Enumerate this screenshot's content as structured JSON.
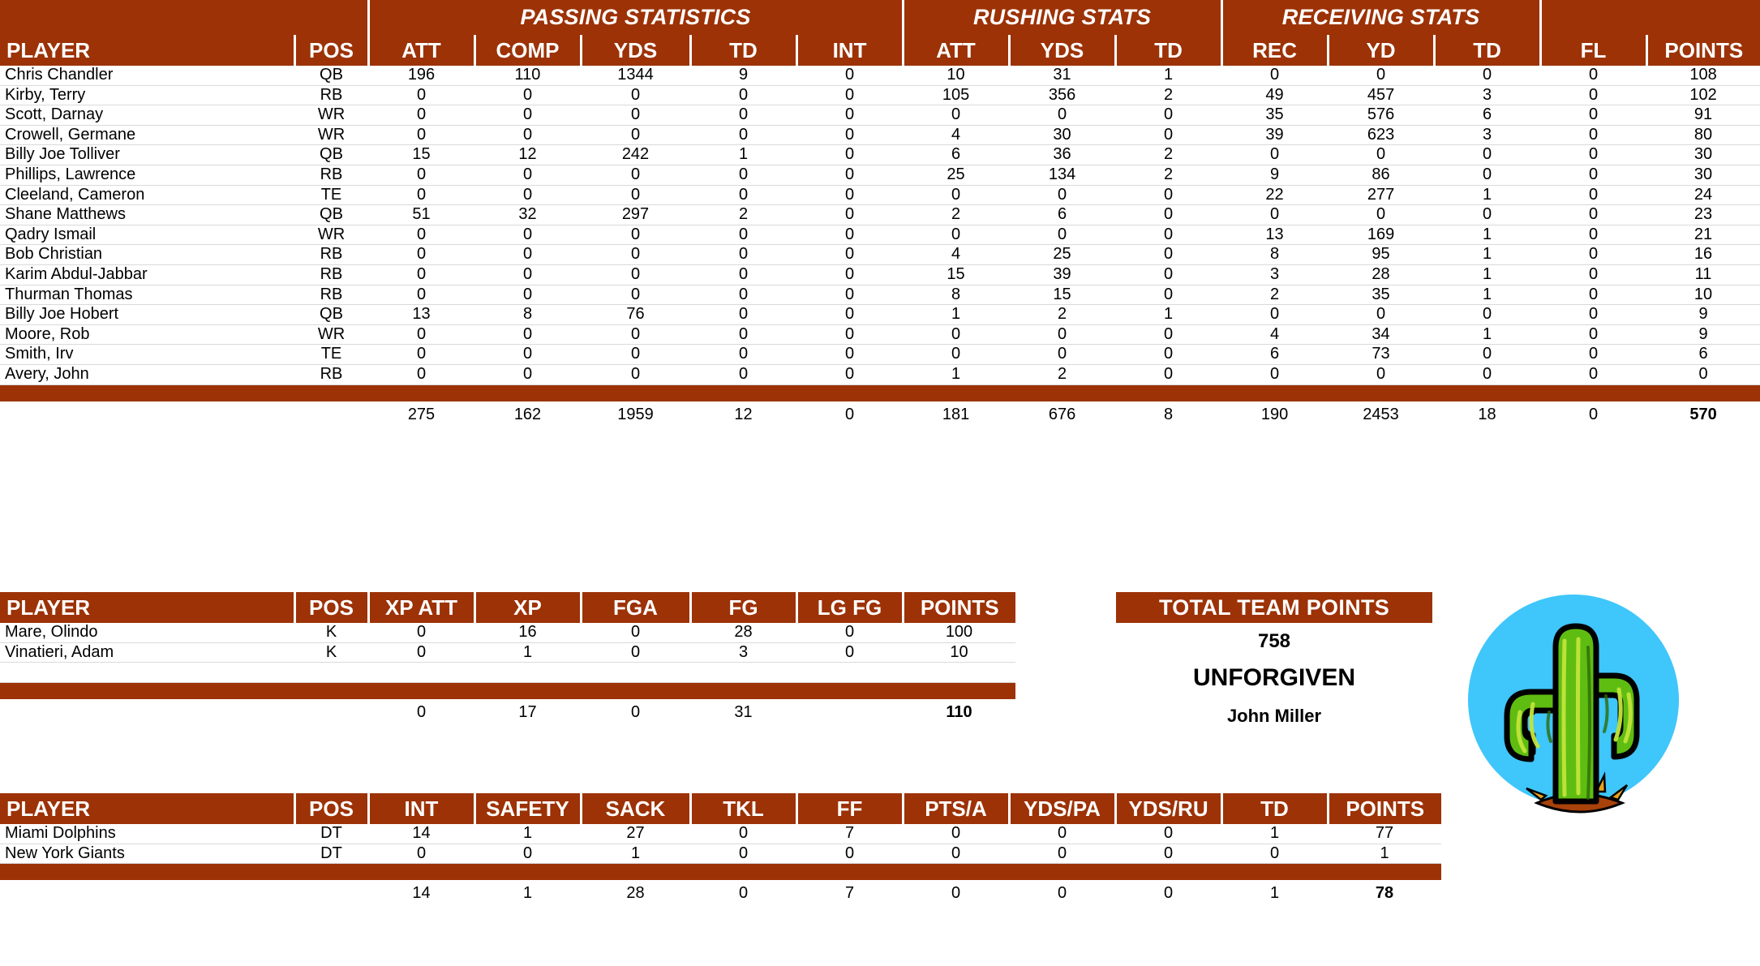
{
  "colors": {
    "header_bg": "#9c3206",
    "header_text": "#ffffff",
    "grid_line": "#dadada",
    "logo_circle": "#3fc6fb",
    "logo_cactus": "#6fbf12",
    "logo_dirt": "#a8420a"
  },
  "offense": {
    "group_headers": [
      {
        "label": "",
        "span": 2
      },
      {
        "label": "PASSING STATISTICS",
        "span": 5
      },
      {
        "label": "RUSHING STATS",
        "span": 3
      },
      {
        "label": "RECEIVING STATS",
        "span": 3
      },
      {
        "label": "",
        "span": 2
      }
    ],
    "columns": [
      "PLAYER",
      "POS",
      "ATT",
      "COMP",
      "YDS",
      "TD",
      "INT",
      "ATT",
      "YDS",
      "TD",
      "REC",
      "YD",
      "TD",
      "FL",
      "POINTS"
    ],
    "rows": [
      {
        "player": "Chris Chandler",
        "pos": "QB",
        "pass_att": "196",
        "pass_comp": "110",
        "pass_yds": "1344",
        "pass_td": "9",
        "pass_int": "0",
        "rush_att": "10",
        "rush_yds": "31",
        "rush_td": "1",
        "rec": "0",
        "rec_yd": "0",
        "rec_td": "0",
        "fl": "0",
        "points": "108"
      },
      {
        "player": "Kirby, Terry",
        "pos": "RB",
        "pass_att": "0",
        "pass_comp": "0",
        "pass_yds": "0",
        "pass_td": "0",
        "pass_int": "0",
        "rush_att": "105",
        "rush_yds": "356",
        "rush_td": "2",
        "rec": "49",
        "rec_yd": "457",
        "rec_td": "3",
        "fl": "0",
        "points": "102"
      },
      {
        "player": "Scott, Darnay",
        "pos": "WR",
        "pass_att": "0",
        "pass_comp": "0",
        "pass_yds": "0",
        "pass_td": "0",
        "pass_int": "0",
        "rush_att": "0",
        "rush_yds": "0",
        "rush_td": "0",
        "rec": "35",
        "rec_yd": "576",
        "rec_td": "6",
        "fl": "0",
        "points": "91"
      },
      {
        "player": "Crowell, Germane",
        "pos": "WR",
        "pass_att": "0",
        "pass_comp": "0",
        "pass_yds": "0",
        "pass_td": "0",
        "pass_int": "0",
        "rush_att": "4",
        "rush_yds": "30",
        "rush_td": "0",
        "rec": "39",
        "rec_yd": "623",
        "rec_td": "3",
        "fl": "0",
        "points": "80"
      },
      {
        "player": "Billy Joe Tolliver",
        "pos": "QB",
        "pass_att": "15",
        "pass_comp": "12",
        "pass_yds": "242",
        "pass_td": "1",
        "pass_int": "0",
        "rush_att": "6",
        "rush_yds": "36",
        "rush_td": "2",
        "rec": "0",
        "rec_yd": "0",
        "rec_td": "0",
        "fl": "0",
        "points": "30"
      },
      {
        "player": "Phillips, Lawrence",
        "pos": "RB",
        "pass_att": "0",
        "pass_comp": "0",
        "pass_yds": "0",
        "pass_td": "0",
        "pass_int": "0",
        "rush_att": "25",
        "rush_yds": "134",
        "rush_td": "2",
        "rec": "9",
        "rec_yd": "86",
        "rec_td": "0",
        "fl": "0",
        "points": "30"
      },
      {
        "player": "Cleeland, Cameron",
        "pos": "TE",
        "pass_att": "0",
        "pass_comp": "0",
        "pass_yds": "0",
        "pass_td": "0",
        "pass_int": "0",
        "rush_att": "0",
        "rush_yds": "0",
        "rush_td": "0",
        "rec": "22",
        "rec_yd": "277",
        "rec_td": "1",
        "fl": "0",
        "points": "24"
      },
      {
        "player": "Shane Matthews",
        "pos": "QB",
        "pass_att": "51",
        "pass_comp": "32",
        "pass_yds": "297",
        "pass_td": "2",
        "pass_int": "0",
        "rush_att": "2",
        "rush_yds": "6",
        "rush_td": "0",
        "rec": "0",
        "rec_yd": "0",
        "rec_td": "0",
        "fl": "0",
        "points": "23"
      },
      {
        "player": "Qadry Ismail",
        "pos": "WR",
        "pass_att": "0",
        "pass_comp": "0",
        "pass_yds": "0",
        "pass_td": "0",
        "pass_int": "0",
        "rush_att": "0",
        "rush_yds": "0",
        "rush_td": "0",
        "rec": "13",
        "rec_yd": "169",
        "rec_td": "1",
        "fl": "0",
        "points": "21"
      },
      {
        "player": "Bob Christian",
        "pos": "RB",
        "pass_att": "0",
        "pass_comp": "0",
        "pass_yds": "0",
        "pass_td": "0",
        "pass_int": "0",
        "rush_att": "4",
        "rush_yds": "25",
        "rush_td": "0",
        "rec": "8",
        "rec_yd": "95",
        "rec_td": "1",
        "fl": "0",
        "points": "16"
      },
      {
        "player": "Karim Abdul-Jabbar",
        "pos": "RB",
        "pass_att": "0",
        "pass_comp": "0",
        "pass_yds": "0",
        "pass_td": "0",
        "pass_int": "0",
        "rush_att": "15",
        "rush_yds": "39",
        "rush_td": "0",
        "rec": "3",
        "rec_yd": "28",
        "rec_td": "1",
        "fl": "0",
        "points": "11"
      },
      {
        "player": "Thurman Thomas",
        "pos": "RB",
        "pass_att": "0",
        "pass_comp": "0",
        "pass_yds": "0",
        "pass_td": "0",
        "pass_int": "0",
        "rush_att": "8",
        "rush_yds": "15",
        "rush_td": "0",
        "rec": "2",
        "rec_yd": "35",
        "rec_td": "1",
        "fl": "0",
        "points": "10"
      },
      {
        "player": "Billy Joe Hobert",
        "pos": "QB",
        "pass_att": "13",
        "pass_comp": "8",
        "pass_yds": "76",
        "pass_td": "0",
        "pass_int": "0",
        "rush_att": "1",
        "rush_yds": "2",
        "rush_td": "1",
        "rec": "0",
        "rec_yd": "0",
        "rec_td": "0",
        "fl": "0",
        "points": "9"
      },
      {
        "player": "Moore, Rob",
        "pos": "WR",
        "pass_att": "0",
        "pass_comp": "0",
        "pass_yds": "0",
        "pass_td": "0",
        "pass_int": "0",
        "rush_att": "0",
        "rush_yds": "0",
        "rush_td": "0",
        "rec": "4",
        "rec_yd": "34",
        "rec_td": "1",
        "fl": "0",
        "points": "9"
      },
      {
        "player": "Smith, Irv",
        "pos": "TE",
        "pass_att": "0",
        "pass_comp": "0",
        "pass_yds": "0",
        "pass_td": "0",
        "pass_int": "0",
        "rush_att": "0",
        "rush_yds": "0",
        "rush_td": "0",
        "rec": "6",
        "rec_yd": "73",
        "rec_td": "0",
        "fl": "0",
        "points": "6"
      },
      {
        "player": "Avery, John",
        "pos": "RB",
        "pass_att": "0",
        "pass_comp": "0",
        "pass_yds": "0",
        "pass_td": "0",
        "pass_int": "0",
        "rush_att": "1",
        "rush_yds": "2",
        "rush_td": "0",
        "rec": "0",
        "rec_yd": "0",
        "rec_td": "0",
        "fl": "0",
        "points": "0"
      }
    ],
    "totals": {
      "player": "",
      "pos": "",
      "pass_att": "275",
      "pass_comp": "162",
      "pass_yds": "1959",
      "pass_td": "12",
      "pass_int": "0",
      "rush_att": "181",
      "rush_yds": "676",
      "rush_td": "8",
      "rec": "190",
      "rec_yd": "2453",
      "rec_td": "18",
      "fl": "0",
      "points": "570"
    }
  },
  "kicking": {
    "columns": [
      "PLAYER",
      "POS",
      "XP ATT",
      "XP",
      "FGA",
      "FG",
      "LG FG",
      "POINTS"
    ],
    "rows": [
      {
        "player": "Mare, Olindo",
        "pos": "K",
        "xp_att": "0",
        "xp": "16",
        "fga": "0",
        "fg": "28",
        "lg_fg": "0",
        "points": "100"
      },
      {
        "player": "Vinatieri, Adam",
        "pos": "K",
        "xp_att": "0",
        "xp": "1",
        "fga": "0",
        "fg": "3",
        "lg_fg": "0",
        "points": "10"
      }
    ],
    "totals": {
      "player": "",
      "pos": "",
      "xp_att": "0",
      "xp": "17",
      "fga": "0",
      "fg": "31",
      "lg_fg": "",
      "points": "110"
    }
  },
  "defense": {
    "columns": [
      "PLAYER",
      "POS",
      "INT",
      "SAFETY",
      "SACK",
      "TKL",
      "FF",
      "PTS/A",
      "YDS/PA",
      "YDS/RU",
      "TD",
      "POINTS"
    ],
    "rows": [
      {
        "player": "Miami Dolphins",
        "pos": "DT",
        "int": "14",
        "safety": "1",
        "sack": "27",
        "tkl": "0",
        "ff": "7",
        "pts_a": "0",
        "yds_pa": "0",
        "yds_ru": "0",
        "td": "1",
        "points": "77"
      },
      {
        "player": "New York Giants",
        "pos": "DT",
        "int": "0",
        "safety": "0",
        "sack": "1",
        "tkl": "0",
        "ff": "0",
        "pts_a": "0",
        "yds_pa": "0",
        "yds_ru": "0",
        "td": "0",
        "points": "1"
      }
    ],
    "totals": {
      "player": "",
      "pos": "",
      "int": "14",
      "safety": "1",
      "sack": "28",
      "tkl": "0",
      "ff": "7",
      "pts_a": "0",
      "yds_pa": "0",
      "yds_ru": "0",
      "td": "1",
      "points": "78"
    }
  },
  "team_summary": {
    "header": "TOTAL TEAM POINTS",
    "total_points": "758",
    "team_name": "UNFORGIVEN",
    "manager": "John Miller"
  }
}
